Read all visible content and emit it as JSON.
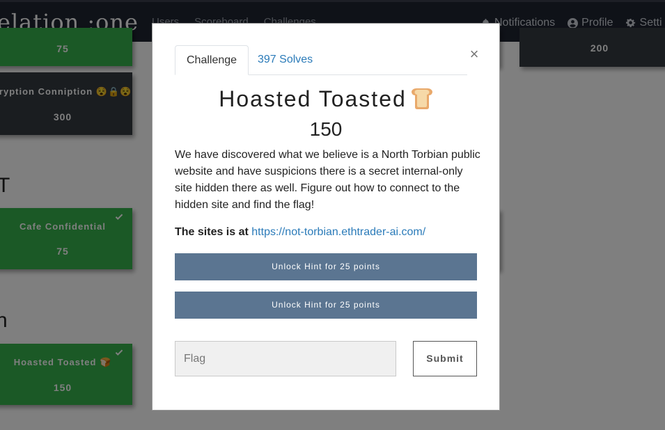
{
  "navbar": {
    "brand": "elation :one",
    "links": [
      "Users",
      "Scoreboard",
      "Challenges"
    ],
    "notifications_label": "Notifications",
    "profile_label": "Profile",
    "settings_label": "Setti"
  },
  "background": {
    "cards": [
      {
        "title": "",
        "value": "75"
      },
      {
        "title": "cryption Conniption 😵🔒😵",
        "value": "300"
      },
      {
        "title": "",
        "value": "200"
      },
      {
        "title": "Cafe Confidential",
        "value": "75"
      },
      {
        "title": "Hoasted Toasted 🍞",
        "value": "150"
      }
    ],
    "categories": [
      "T",
      "n"
    ]
  },
  "modal": {
    "tabs": [
      "Challenge",
      "397 Solves"
    ],
    "close": "×",
    "title": "Hoasted Toasted",
    "value": "150",
    "description": "We have discovered what we believe is a North Torbian public website and have suspicions there is a secret internal-only site hidden there as well. Figure out how to connect to the hidden site and find the flag!",
    "site_label": "The sites is at",
    "site_url": "https://not-torbian.ethtrader-ai.com/",
    "hints": [
      "Unlock Hint for 25 points",
      "Unlock Hint for 25 points"
    ],
    "flag_placeholder": "Flag",
    "submit_label": "Submit"
  },
  "colors": {
    "navbar": "#1f2431",
    "solved_card": "#37b24d",
    "unsolved_card": "#343a40",
    "hint_button": "#5b7591",
    "link": "#2b7bb9"
  }
}
